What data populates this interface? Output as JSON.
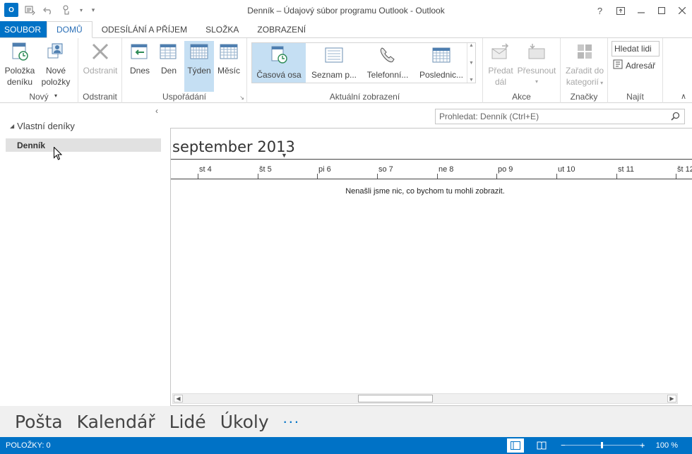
{
  "window": {
    "title": "Denník – Údajový súbor programu Outlook - Outlook",
    "app_icon_label": "O",
    "controls": [
      "?",
      "restore",
      "minimize",
      "maximize",
      "close"
    ]
  },
  "ribbon_tabs": [
    "SOUBOR",
    "DOMŮ",
    "ODESÍLÁNÍ A PŘÍJEM",
    "SLOŽKA",
    "ZOBRAZENÍ"
  ],
  "active_tab": "DOMŮ",
  "ribbon": {
    "groups": {
      "novy": "Nový",
      "odstranit": "Odstranit",
      "usporadani": "Uspořádání",
      "aktualni": "Aktuální zobrazení",
      "akce": "Akce",
      "znacky": "Značky",
      "najit": "Najít"
    },
    "buttons": {
      "polozka_l1": "Položka",
      "polozka_l2": "deníku",
      "nove_l1": "Nové",
      "nove_l2": "položky",
      "odstranit": "Odstranit",
      "dnes": "Dnes",
      "den": "Den",
      "tyden": "Týden",
      "mesic": "Měsíc",
      "predat_l1": "Předat",
      "predat_l2": "dál",
      "presunout": "Přesunout",
      "zaradit_l1": "Zařadit do",
      "zaradit_l2": "kategorií"
    },
    "views": [
      "Časová osa",
      "Seznam p...",
      "Telefonní...",
      "Poslednic..."
    ],
    "search_people_placeholder": "Hledat lidi",
    "address_book": "Adresář"
  },
  "folder_pane": {
    "group": "Vlastní deníky",
    "selected_folder": "Denník"
  },
  "search": {
    "placeholder": "Prohledat: Denník (Ctrl+E)"
  },
  "timeline": {
    "month": "september 2013",
    "days": [
      "st 4",
      "št 5",
      "pi 6",
      "so 7",
      "ne 8",
      "po 9",
      "ut 10",
      "st 11",
      "št 12"
    ],
    "empty_message": "Nenašli jsme nic, co bychom tu mohli zobrazit."
  },
  "navigation": {
    "items": [
      "Pošta",
      "Kalendář",
      "Lidé",
      "Úkoly"
    ],
    "more": "..."
  },
  "status": {
    "items_count": "POLOŽKY: 0",
    "zoom": "100 %"
  },
  "colors": {
    "accent": "#0072c6",
    "selected": "#c5dff3"
  }
}
